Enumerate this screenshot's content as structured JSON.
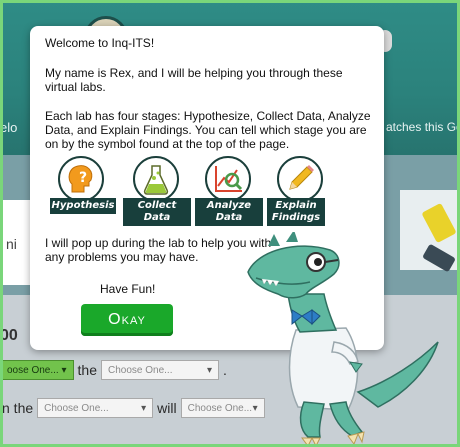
{
  "background": {
    "left_fragment": "elo",
    "right_fragment": "atches this Go",
    "mid_fragment": "ni",
    "lower_fragment": "00",
    "row1": {
      "select1": "oose One...",
      "word": "the",
      "select2": "Choose One...",
      "punct": "."
    },
    "row2": {
      "word1": "n the",
      "select1": "Choose One...",
      "word2": "will",
      "select2": "Choose One..."
    }
  },
  "modal": {
    "welcome": "Welcome to Inq-ITS!",
    "intro": "My name is Rex, and I will be helping you through these virtual labs.",
    "stages_text": "Each lab has four stages: Hypothesize, Collect Data, Analyze Data, and Explain Findings. You can tell which stage you are on by the symbol found at the top of the page.",
    "stages": [
      {
        "label": "Hypothesis",
        "icon": "head-question-icon"
      },
      {
        "label": "Collect Data",
        "icon": "flask-icon"
      },
      {
        "label": "Analyze Data",
        "icon": "chart-magnifier-icon"
      },
      {
        "label": "Explain Findings",
        "icon": "pencil-icon"
      }
    ],
    "popup_text": "I will pop up during the lab to help you with any problems you may have.",
    "have_fun": "Have Fun!",
    "okay_label": "Okay"
  },
  "colors": {
    "teal_bg": "#2e8a84",
    "okay_green": "#1aa82a",
    "banner_dark": "#183f3c",
    "dino_green": "#5fb8a0"
  }
}
